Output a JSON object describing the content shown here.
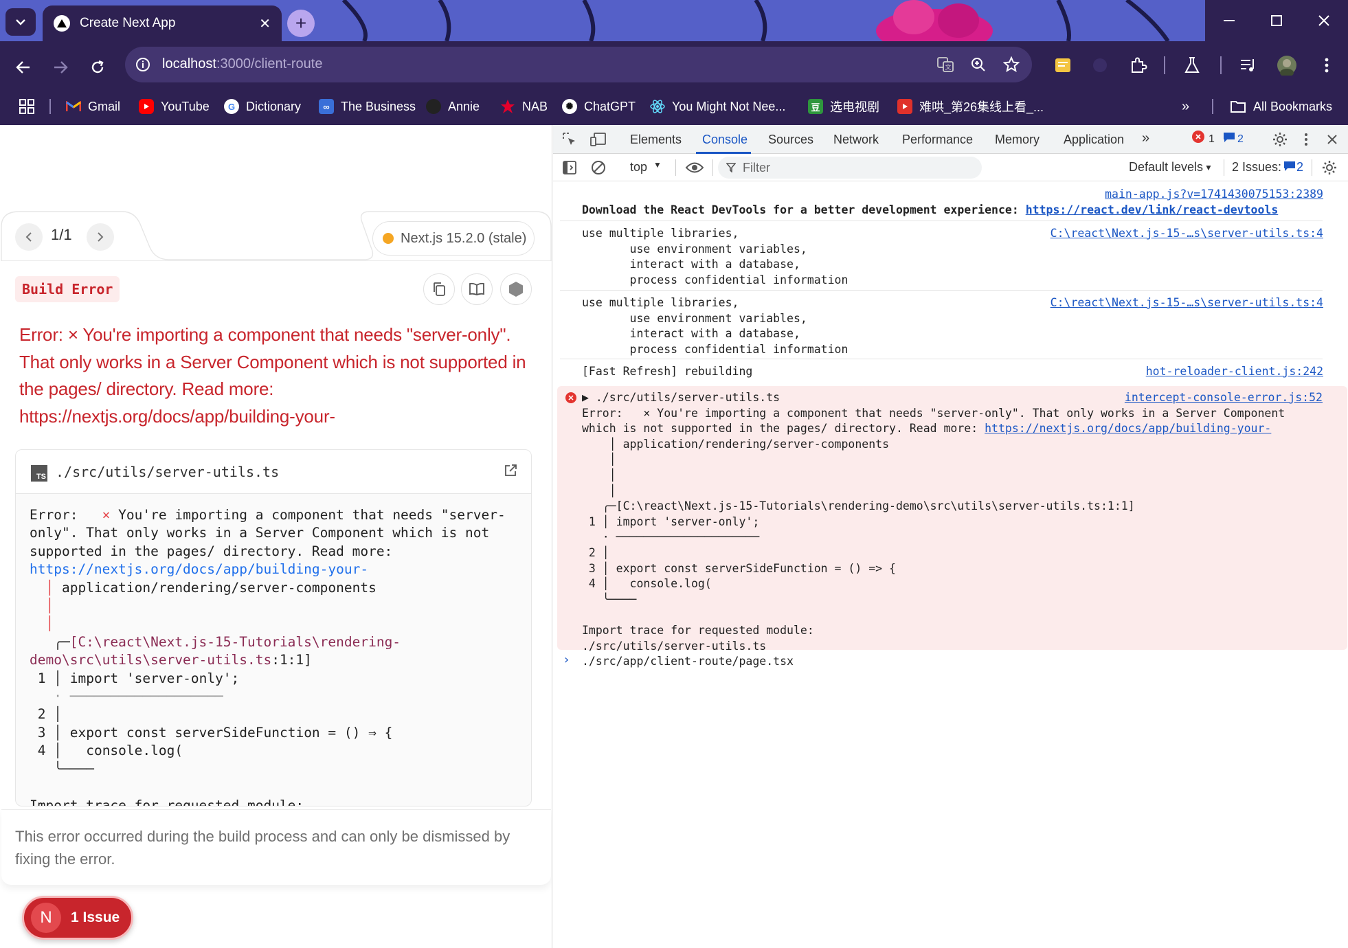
{
  "browser": {
    "tab_title": "Create Next App",
    "new_tab": "+",
    "url_host": "localhost",
    "url_path": ":3000/client-route",
    "bookmarks": [
      {
        "label": "Gmail",
        "icon": "gmail-icon"
      },
      {
        "label": "YouTube",
        "icon": "youtube-icon"
      },
      {
        "label": "Dictionary",
        "icon": "google-icon"
      },
      {
        "label": "The Business",
        "icon": "abc-icon"
      },
      {
        "label": "Annie",
        "icon": "github-icon"
      },
      {
        "label": "NAB",
        "icon": "nab-icon"
      },
      {
        "label": "ChatGPT",
        "icon": "openai-icon"
      },
      {
        "label": "You Might Not Nee...",
        "icon": "react-icon"
      },
      {
        "label": "选电视剧",
        "icon": "douban-icon"
      },
      {
        "label": "难哄_第26集线上看_...",
        "icon": "video-icon"
      }
    ],
    "all_bookmarks": "All Bookmarks",
    "colors": {
      "tabstrip": "#5560c8",
      "chrome": "#2e2152",
      "omnibox": "#433570"
    }
  },
  "overlay": {
    "pager": "1/1",
    "version": "Next.js 15.2.0 (stale)",
    "badge": "Build Error",
    "error_title": "Error:   × You're importing a component that needs \"server-only\". That only works in a Server Component which is not supported in the pages/ directory. Read more: https://nextjs.org/docs/app/building-your-",
    "file": "./src/utils/server-utils.ts",
    "file_icon": "TS",
    "code": {
      "l1a": "Error:   ",
      "l1x": "×",
      "l1b": " You're importing a component that needs \"server-",
      "l2": "only\". That only works in a Server Component which is not",
      "l3": "supported in the pages/ directory. Read more:",
      "l4": "https://nextjs.org/docs/app/building-your-",
      "l5": "application/rendering/server-components",
      "l8a": "[C:\\react\\Next.js-15-Tutorials\\rendering-",
      "l9a": "demo\\src\\utils\\server-utils.ts",
      "l9b": ":1:1]",
      "ln1": "1",
      "c1": "import 'server-only';",
      "ln2": "2",
      "ln3": "3",
      "c3": "export const serverSideFunction = () ⇒ {",
      "ln4": "4",
      "c4": "  console.log(",
      "trace": "Import trace for requested module:"
    },
    "footer": "This error occurred during the build process and can only be dismissed by fixing the error.",
    "issue_letter": "N",
    "issue_label": "1 Issue",
    "colors": {
      "error": "#c8252c",
      "badge_bg": "#fdecec",
      "version_dot": "#f5a623"
    }
  },
  "devtools": {
    "tabs": [
      "Elements",
      "Console",
      "Sources",
      "Network",
      "Performance",
      "Memory",
      "Application"
    ],
    "active_tab": "Console",
    "error_count": "1",
    "warning_count": "2",
    "context": "top",
    "filter_placeholder": "Filter",
    "levels": "Default levels",
    "issues_label": "2 Issues:",
    "issues_count": "2",
    "messages": [
      {
        "source": "main-app.js?v=1741430075153:2389",
        "text_prefix": "Download the React DevTools for a better development experience: ",
        "link": "https://react.dev/link/react-devtools"
      },
      {
        "source": "C:\\react\\Next.js-15-…s\\server-utils.ts:4",
        "text": "use multiple libraries,\n       use environment variables,\n       interact with a database,\n       process confidential information"
      },
      {
        "source": "C:\\react\\Next.js-15-…s\\server-utils.ts:4",
        "text": "use multiple libraries,\n       use environment variables,\n       interact with a database,\n       process confidential information"
      },
      {
        "source": "hot-reloader-client.js:242",
        "text": "[Fast Refresh] rebuilding"
      }
    ],
    "error": {
      "source": "intercept-console-error.js:52",
      "summary": "▶ ./src/utils/server-utils.ts",
      "line1": "Error:   × You're importing a component that needs \"server-only\". That only works in a Server Component",
      "line2_prefix": "which is not supported in the pages/ directory. Read more: ",
      "line2_link": "https://nextjs.org/docs/app/building-your-",
      "body": "    │ application/rendering/server-components\n    │\n    │\n    │\n   ╭─[C:\\react\\Next.js-15-Tutorials\\rendering-demo\\src\\utils\\server-utils.ts:1:1]\n 1 │ import 'server-only';\n   · ─────────────────────\n 2 │\n 3 │ export const serverSideFunction = () => {\n 4 │   console.log(\n   ╰────\n\nImport trace for requested module:\n./src/utils/server-utils.ts\n./src/app/client-route/page.tsx"
    },
    "prompt": "›"
  }
}
